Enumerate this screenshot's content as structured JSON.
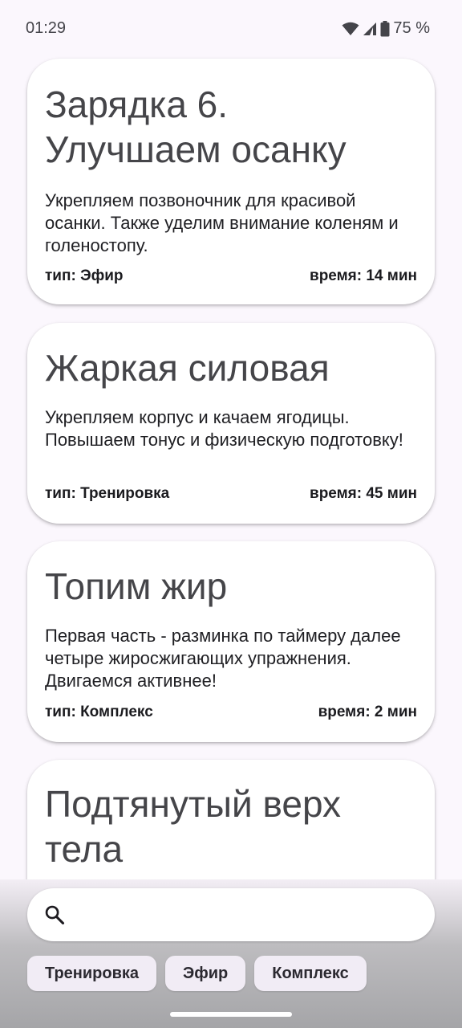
{
  "status": {
    "time": "01:29",
    "battery": "75 %"
  },
  "cards": [
    {
      "title": "Зарядка 6. Улучшаем осанку",
      "description": "Укрепляем позвоночник для красивой осанки. Также уделим внимание коленям и голеностопу.",
      "type": "тип: Эфир",
      "time": "время: 14 мин"
    },
    {
      "title": "Жаркая силовая",
      "description": "Укрепляем корпус и качаем ягодицы. Повышаем тонус и физическую подготовку!",
      "type": "тип: Тренировка",
      "time": "время: 45 мин"
    },
    {
      "title": "Топим жир",
      "description": "Первая часть - разминка по таймеру далее четыре жиросжигающих упражнения. Двигаемся активнее!",
      "type": "тип: Комплекс",
      "time": "время: 2 мин"
    },
    {
      "title": "Подтянутый верх тела"
    }
  ],
  "search": {
    "placeholder": "",
    "value": ""
  },
  "filters": [
    "Тренировка",
    "Эфир",
    "Комплекс"
  ]
}
